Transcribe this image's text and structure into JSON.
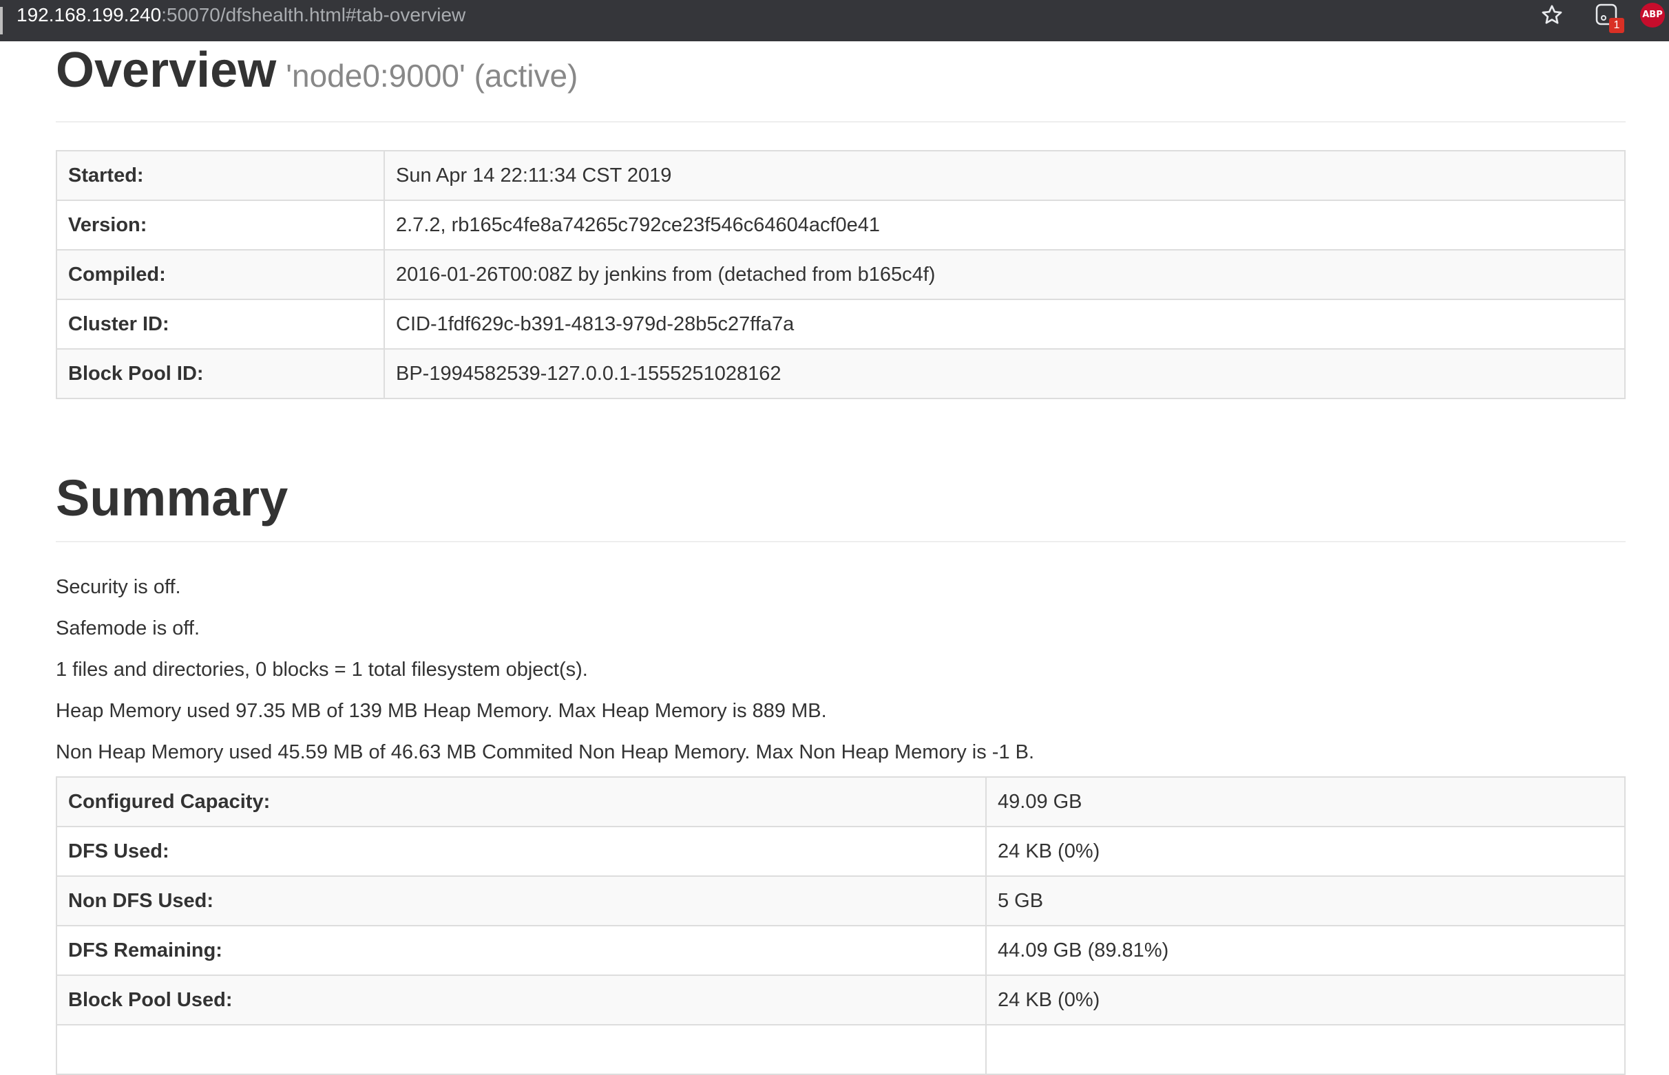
{
  "browser": {
    "url_host": "192.168.199.240",
    "url_path": ":50070/dfshealth.html#tab-overview",
    "extension_badge": "1",
    "abp_label": "ABP",
    "icons": [
      "star-icon",
      "extension-icon",
      "adblock-plus-icon"
    ]
  },
  "overview": {
    "title": "Overview",
    "subtitle": "'node0:9000' (active)",
    "rows": [
      {
        "label": "Started:",
        "value": "Sun Apr 14 22:11:34 CST 2019"
      },
      {
        "label": "Version:",
        "value": "2.7.2, rb165c4fe8a74265c792ce23f546c64604acf0e41"
      },
      {
        "label": "Compiled:",
        "value": "2016-01-26T00:08Z by jenkins from (detached from b165c4f)"
      },
      {
        "label": "Cluster ID:",
        "value": "CID-1fdf629c-b391-4813-979d-28b5c27ffa7a"
      },
      {
        "label": "Block Pool ID:",
        "value": "BP-1994582539-127.0.0.1-1555251028162"
      }
    ]
  },
  "summary": {
    "title": "Summary",
    "lines": [
      "Security is off.",
      "Safemode is off.",
      "1 files and directories, 0 blocks = 1 total filesystem object(s).",
      "Heap Memory used 97.35 MB of 139 MB Heap Memory. Max Heap Memory is 889 MB.",
      "Non Heap Memory used 45.59 MB of 46.63 MB Commited Non Heap Memory. Max Non Heap Memory is -1 B."
    ],
    "capacity_rows": [
      {
        "label": "Configured Capacity:",
        "value": "49.09 GB"
      },
      {
        "label": "DFS Used:",
        "value": "24 KB (0%)"
      },
      {
        "label": "Non DFS Used:",
        "value": "5 GB"
      },
      {
        "label": "DFS Remaining:",
        "value": "44.09 GB (89.81%)"
      },
      {
        "label": "Block Pool Used:",
        "value": "24 KB (0%)"
      },
      {
        "label": "",
        "value": ""
      }
    ]
  }
}
